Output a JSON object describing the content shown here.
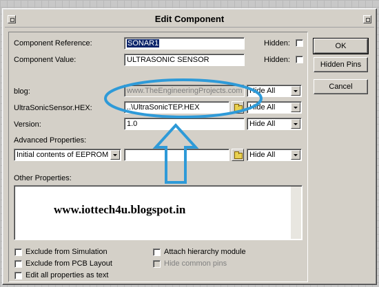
{
  "dialog": {
    "title": "Edit Component"
  },
  "fields": {
    "component_reference": {
      "label": "Component Reference:",
      "value": "SONAR1",
      "hidden_label": "Hidden:"
    },
    "component_value": {
      "label": "Component Value:",
      "value": "ULTRASONIC SENSOR",
      "hidden_label": "Hidden:"
    },
    "blog": {
      "label": "blog:",
      "value": "www.TheEngineeringProjects.com",
      "visibility": "Hide All"
    },
    "hex_file": {
      "label": "UltraSonicSensor.HEX:",
      "value": "..\\UltraSonicTEP.HEX",
      "visibility": "Hide All"
    },
    "version": {
      "label": "Version:",
      "value": "1.0",
      "visibility": "Hide All"
    }
  },
  "advanced": {
    "label": "Advanced Properties:",
    "property": "Initial contents of EEPROM",
    "value": "",
    "visibility": "Hide All"
  },
  "other": {
    "label": "Other Properties:",
    "text": "www.iottech4u.blogspot.in"
  },
  "checkboxes": {
    "exclude_simulation": "Exclude from Simulation",
    "exclude_pcb": "Exclude from PCB Layout",
    "edit_all": "Edit all properties as text",
    "attach_hierarchy": "Attach hierarchy module",
    "hide_common_pins": "Hide common pins"
  },
  "buttons": {
    "ok": "OK",
    "hidden_pins": "Hidden Pins",
    "cancel": "Cancel"
  },
  "annotation": {
    "color": "#2e9ad8"
  }
}
